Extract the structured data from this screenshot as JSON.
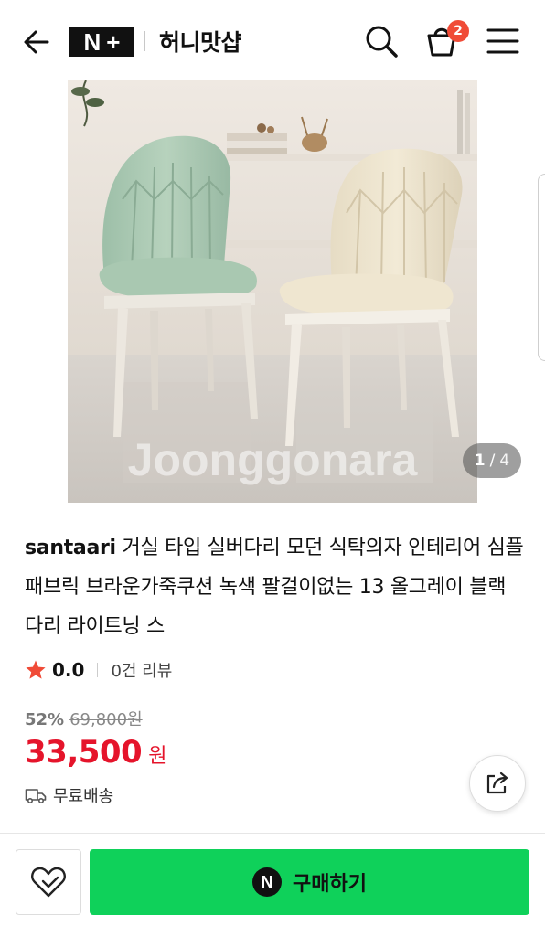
{
  "header": {
    "logo_left": "N",
    "logo_right": "+",
    "store_name": "허니맛샵",
    "cart_count": "2"
  },
  "image": {
    "watermark": "Joonggonara",
    "current_page": "1",
    "separator": "/",
    "total_pages": "4"
  },
  "product": {
    "brand": "santaari",
    "title": " 거실 타입 실버다리 모던 식탁의자 인테리어 심플 패브릭 브라운가죽쿠션 녹색 팔걸이없는 13 올그레이 블랙 다리 라이트닝 스",
    "rating": "0.0",
    "review_count": "0건 리뷰",
    "discount": "52%",
    "original_price": "69,800원",
    "price": "33,500",
    "currency": "원",
    "shipping": "무료배송"
  },
  "actions": {
    "buy_label": "구매하기",
    "npay_letter": "N"
  },
  "colors": {
    "accent_green": "#0fd15a",
    "price_red": "#e5142b",
    "badge_red": "#f04b37",
    "star_red": "#f04b37"
  },
  "icons": [
    "back-arrow-icon",
    "search-icon",
    "cart-icon",
    "menu-icon",
    "star-icon",
    "truck-icon",
    "share-icon",
    "heart-icon"
  ]
}
